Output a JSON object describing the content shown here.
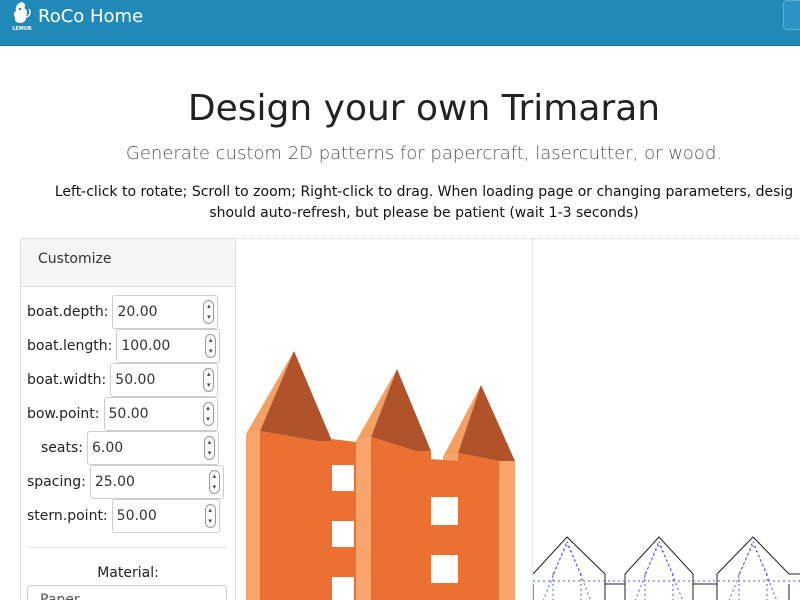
{
  "nav": {
    "brand_title": "RoCo Home",
    "logo_text": "LEMUR"
  },
  "header": {
    "title": "Design your own Trimaran",
    "subtitle": "Generate custom 2D patterns for papercraft, lasercutter, or wood.",
    "instructions_line1": "Left-click to rotate; Scroll to zoom; Right-click to drag. When loading page or changing parameters, desig",
    "instructions_line2": "should auto-refresh, but please be patient (wait 1-3 seconds)"
  },
  "customize": {
    "heading": "Customize",
    "params": [
      {
        "label": "boat.depth:",
        "value": "20.00"
      },
      {
        "label": "boat.length:",
        "value": "100.00"
      },
      {
        "label": "boat.width:",
        "value": "50.00"
      },
      {
        "label": "bow.point:",
        "value": "50.00"
      },
      {
        "label": "seats:",
        "value": "6.00"
      },
      {
        "label": "spacing:",
        "value": "25.00"
      },
      {
        "label": "stern.point:",
        "value": "50.00"
      }
    ],
    "material_label": "Material:",
    "material_value": "Paper"
  },
  "colors": {
    "navbar": "#1f8ab8",
    "hull_main": "#ec7032",
    "hull_light": "#f7a46e",
    "hull_dark": "#b0532b",
    "pattern_line": "#222222",
    "fold_line": "#5555ee"
  },
  "icons": {
    "logo": "lemur-logo-icon",
    "spinner": "spinner-arrows-icon"
  }
}
